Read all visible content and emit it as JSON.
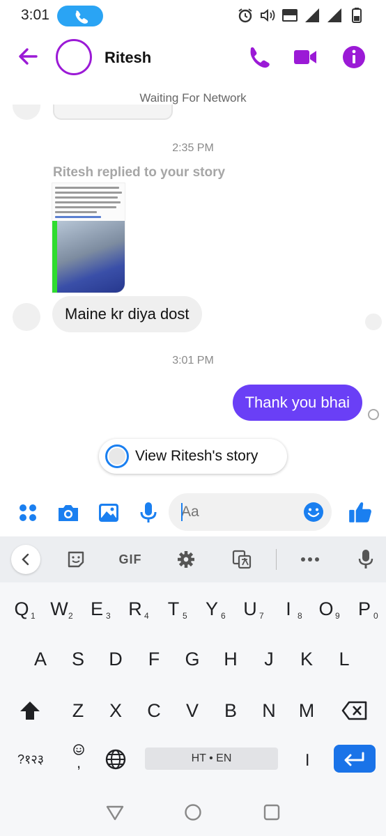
{
  "status_bar": {
    "time": "3:01",
    "icons": [
      "phone-call-icon",
      "alarm-icon",
      "volume-icon",
      "volte-icon",
      "signal-icon",
      "signal-roaming-icon",
      "battery-icon"
    ]
  },
  "header": {
    "contact_name": "Ritesh",
    "icons": [
      "back-arrow-icon",
      "phone-icon",
      "video-camera-icon",
      "info-icon"
    ],
    "accent_color": "#9b1ad6"
  },
  "network_status": "Waiting For Network",
  "conversation": {
    "timestamp_1": "2:35 PM",
    "reply_note": "Ritesh replied to your story",
    "incoming_message": "Maine kr diya dost",
    "timestamp_2": "3:01 PM",
    "outgoing_message": "Thank you bhai",
    "outgoing_bubble_color": "#6a3ff6",
    "view_story_label": "View Ritesh's story"
  },
  "composer": {
    "placeholder": "Aa",
    "icons": [
      "apps-grid-icon",
      "camera-icon",
      "gallery-icon",
      "microphone-icon",
      "emoji-icon",
      "thumbs-up-icon"
    ],
    "accent_color": "#1a7ff0"
  },
  "keyboard_toolbar": {
    "gif_label": "GIF",
    "icons": [
      "chevron-left-icon",
      "sticker-icon",
      "settings-gear-icon",
      "translate-icon",
      "more-dots-icon",
      "voice-input-icon"
    ]
  },
  "keyboard": {
    "row1": [
      {
        "letter": "Q",
        "hint": "1"
      },
      {
        "letter": "W",
        "hint": "2"
      },
      {
        "letter": "E",
        "hint": "3"
      },
      {
        "letter": "R",
        "hint": "4"
      },
      {
        "letter": "T",
        "hint": "5"
      },
      {
        "letter": "Y",
        "hint": "6"
      },
      {
        "letter": "U",
        "hint": "7"
      },
      {
        "letter": "I",
        "hint": "8"
      },
      {
        "letter": "O",
        "hint": "9"
      },
      {
        "letter": "P",
        "hint": "0"
      }
    ],
    "row2": [
      "A",
      "S",
      "D",
      "F",
      "G",
      "H",
      "J",
      "K",
      "L"
    ],
    "row3": [
      "Z",
      "X",
      "C",
      "V",
      "B",
      "N",
      "M"
    ],
    "symbols_label": "?१२३",
    "comma_label": ",",
    "space_label": "HT • EN",
    "period_label": "।"
  },
  "nav_bar": {
    "icons": [
      "nav-back-icon",
      "nav-home-icon",
      "nav-recents-icon"
    ]
  }
}
